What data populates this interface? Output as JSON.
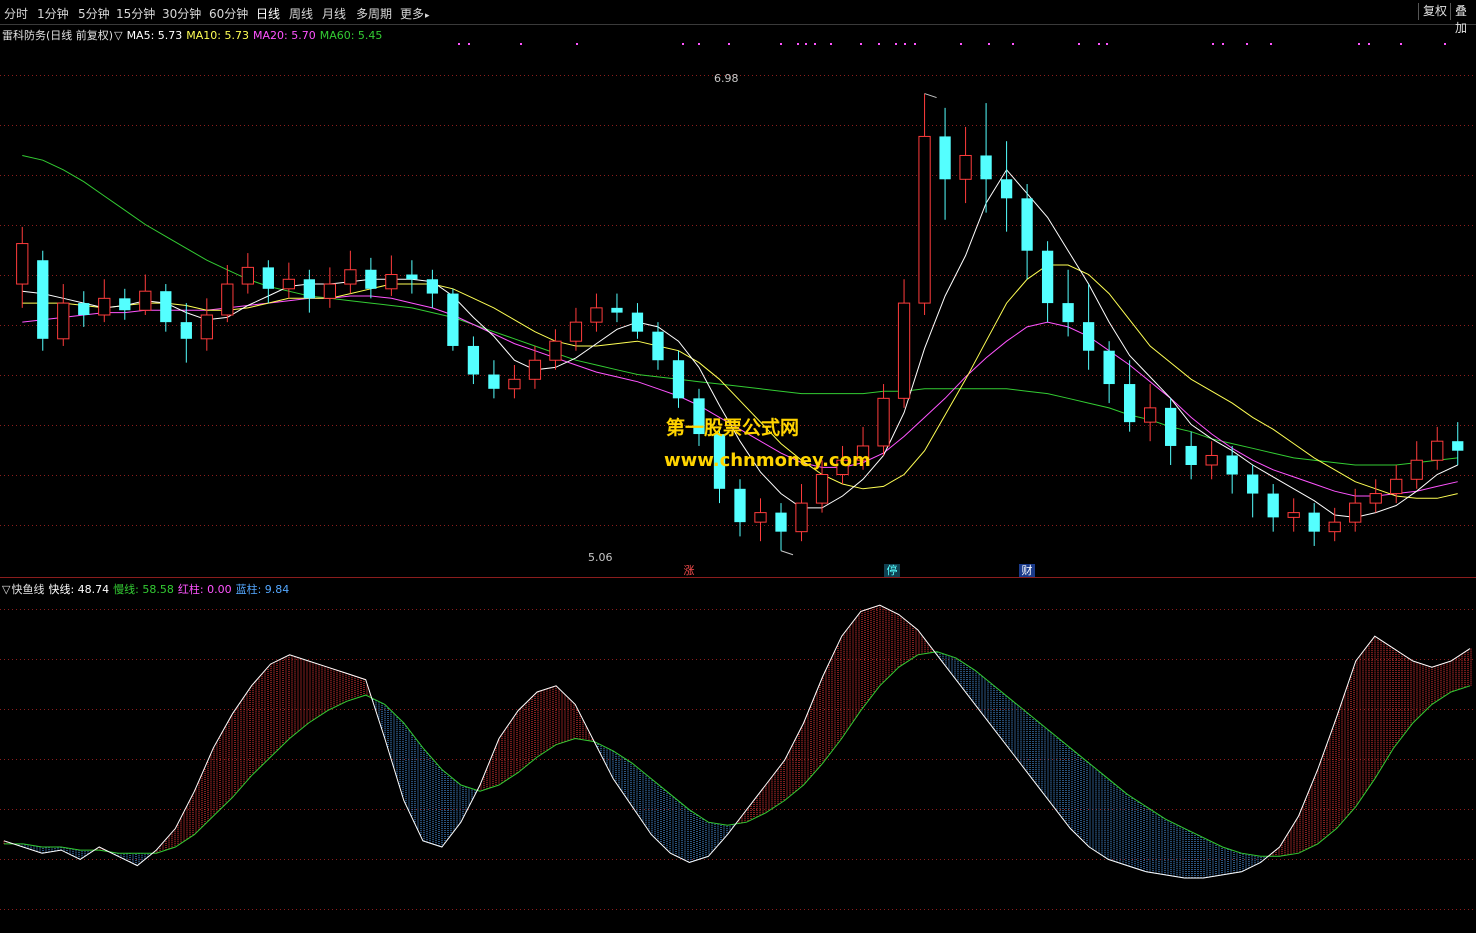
{
  "toolbar": {
    "tabs": [
      {
        "label": "分时",
        "active": false
      },
      {
        "label": "1分钟",
        "active": false
      },
      {
        "label": "5分钟",
        "active": false
      },
      {
        "label": "15分钟",
        "active": false
      },
      {
        "label": "30分钟",
        "active": false
      },
      {
        "label": "60分钟",
        "active": false
      },
      {
        "label": "日线",
        "active": true
      },
      {
        "label": "周线",
        "active": false
      },
      {
        "label": "月线",
        "active": false
      },
      {
        "label": "多周期",
        "active": false
      },
      {
        "label": "更多",
        "active": false
      }
    ],
    "more_arrow": "▸",
    "right_buttons": [
      "复权",
      "叠加"
    ]
  },
  "main_legend": {
    "title": "雷科防务(日线 前复权)",
    "arrow": "▽",
    "ma5": "MA5: 5.73",
    "ma10": "MA10: 5.73",
    "ma20": "MA20: 5.70",
    "ma60": "MA60: 5.45"
  },
  "sub_legend": {
    "arrow": "▽",
    "name": "快鱼线",
    "fast": "快线: 48.74",
    "slow": "慢线: 58.58",
    "red": "红柱: 0.00",
    "blue": "蓝柱: 9.84"
  },
  "annotations": {
    "high": "6.98",
    "low": "5.06"
  },
  "markers": [
    "涨",
    "停",
    "财"
  ],
  "watermark": {
    "line1": "第一股票公式网",
    "line2": "www.chnmoney.com"
  },
  "colors": {
    "up": "#ff3c3c",
    "down": "#54ffff",
    "ma5": "#ffffff",
    "ma10": "#ffff54",
    "ma20": "#ff54ff",
    "ma60": "#33cc33",
    "grid": "#8b1d1d",
    "fast_line": "#ffffff",
    "slow_line": "#33cc33",
    "red_bar": "#ff3c3c",
    "blue_bar": "#54a8ff"
  },
  "chart_data": {
    "type": "candlestick",
    "price_range": [
      5.0,
      7.1
    ],
    "candles": [
      [
        6.18,
        6.35,
        6.42,
        6.08
      ],
      [
        6.28,
        5.95,
        6.32,
        5.9
      ],
      [
        5.95,
        6.1,
        6.18,
        5.92
      ],
      [
        6.1,
        6.05,
        6.15,
        6.0
      ],
      [
        6.05,
        6.12,
        6.2,
        6.02
      ],
      [
        6.12,
        6.07,
        6.16,
        6.03
      ],
      [
        6.07,
        6.15,
        6.22,
        6.05
      ],
      [
        6.15,
        6.02,
        6.18,
        5.98
      ],
      [
        6.02,
        5.95,
        6.1,
        5.85
      ],
      [
        5.95,
        6.05,
        6.12,
        5.9
      ],
      [
        6.05,
        6.18,
        6.26,
        6.02
      ],
      [
        6.18,
        6.25,
        6.31,
        6.14
      ],
      [
        6.25,
        6.16,
        6.28,
        6.1
      ],
      [
        6.16,
        6.2,
        6.27,
        6.12
      ],
      [
        6.2,
        6.12,
        6.24,
        6.06
      ],
      [
        6.12,
        6.18,
        6.25,
        6.08
      ],
      [
        6.18,
        6.24,
        6.32,
        6.14
      ],
      [
        6.24,
        6.16,
        6.29,
        6.12
      ],
      [
        6.16,
        6.22,
        6.3,
        6.13
      ],
      [
        6.22,
        6.2,
        6.28,
        6.14
      ],
      [
        6.2,
        6.14,
        6.24,
        6.08
      ],
      [
        6.14,
        5.92,
        6.16,
        5.9
      ],
      [
        5.92,
        5.8,
        5.96,
        5.76
      ],
      [
        5.8,
        5.74,
        5.86,
        5.7
      ],
      [
        5.74,
        5.78,
        5.84,
        5.7
      ],
      [
        5.78,
        5.86,
        5.92,
        5.74
      ],
      [
        5.86,
        5.94,
        5.99,
        5.82
      ],
      [
        5.94,
        6.02,
        6.08,
        5.9
      ],
      [
        6.02,
        6.08,
        6.14,
        5.98
      ],
      [
        6.08,
        6.06,
        6.14,
        6.02
      ],
      [
        6.06,
        5.98,
        6.1,
        5.95
      ],
      [
        5.98,
        5.86,
        6.02,
        5.82
      ],
      [
        5.86,
        5.7,
        5.9,
        5.66
      ],
      [
        5.7,
        5.55,
        5.74,
        5.5
      ],
      [
        5.55,
        5.32,
        5.58,
        5.26
      ],
      [
        5.32,
        5.18,
        5.36,
        5.12
      ],
      [
        5.18,
        5.22,
        5.28,
        5.1
      ],
      [
        5.22,
        5.14,
        5.26,
        5.06
      ],
      [
        5.14,
        5.26,
        5.34,
        5.1
      ],
      [
        5.26,
        5.38,
        5.44,
        5.22
      ],
      [
        5.38,
        5.44,
        5.5,
        5.34
      ],
      [
        5.44,
        5.5,
        5.58,
        5.4
      ],
      [
        5.5,
        5.7,
        5.76,
        5.46
      ],
      [
        5.7,
        6.1,
        6.2,
        5.66
      ],
      [
        6.1,
        6.8,
        6.98,
        6.05
      ],
      [
        6.8,
        6.62,
        6.92,
        6.45
      ],
      [
        6.62,
        6.72,
        6.84,
        6.52
      ],
      [
        6.72,
        6.62,
        6.94,
        6.48
      ],
      [
        6.62,
        6.54,
        6.78,
        6.4
      ],
      [
        6.54,
        6.32,
        6.6,
        6.2
      ],
      [
        6.32,
        6.1,
        6.36,
        6.02
      ],
      [
        6.1,
        6.02,
        6.24,
        5.96
      ],
      [
        6.02,
        5.9,
        6.18,
        5.82
      ],
      [
        5.9,
        5.76,
        5.94,
        5.68
      ],
      [
        5.76,
        5.6,
        5.86,
        5.56
      ],
      [
        5.6,
        5.66,
        5.76,
        5.52
      ],
      [
        5.66,
        5.5,
        5.7,
        5.42
      ],
      [
        5.5,
        5.42,
        5.56,
        5.36
      ],
      [
        5.42,
        5.46,
        5.52,
        5.36
      ],
      [
        5.46,
        5.38,
        5.5,
        5.3
      ],
      [
        5.38,
        5.3,
        5.42,
        5.2
      ],
      [
        5.3,
        5.2,
        5.34,
        5.14
      ],
      [
        5.2,
        5.22,
        5.28,
        5.14
      ],
      [
        5.22,
        5.14,
        5.26,
        5.08
      ],
      [
        5.14,
        5.18,
        5.24,
        5.1
      ],
      [
        5.18,
        5.26,
        5.32,
        5.14
      ],
      [
        5.26,
        5.3,
        5.36,
        5.22
      ],
      [
        5.3,
        5.36,
        5.42,
        5.26
      ],
      [
        5.36,
        5.44,
        5.52,
        5.32
      ],
      [
        5.44,
        5.52,
        5.58,
        5.4
      ],
      [
        5.52,
        5.48,
        5.6,
        5.42
      ]
    ],
    "ma5": [
      6.15,
      6.14,
      6.12,
      6.1,
      6.08,
      6.09,
      6.11,
      6.1,
      6.06,
      6.03,
      6.04,
      6.09,
      6.13,
      6.17,
      6.18,
      6.18,
      6.19,
      6.2,
      6.2,
      6.2,
      6.19,
      6.13,
      6.04,
      5.96,
      5.86,
      5.82,
      5.83,
      5.87,
      5.93,
      5.99,
      6.02,
      6.0,
      5.94,
      5.83,
      5.67,
      5.52,
      5.39,
      5.3,
      5.24,
      5.24,
      5.29,
      5.36,
      5.46,
      5.64,
      5.91,
      6.13,
      6.3,
      6.52,
      6.66,
      6.56,
      6.46,
      6.32,
      6.18,
      6.02,
      5.88,
      5.79,
      5.7,
      5.59,
      5.53,
      5.48,
      5.42,
      5.37,
      5.32,
      5.27,
      5.21,
      5.2,
      5.22,
      5.25,
      5.31,
      5.38,
      5.42
    ],
    "ma10": [
      6.1,
      6.1,
      6.1,
      6.09,
      6.08,
      6.09,
      6.1,
      6.1,
      6.09,
      6.07,
      6.07,
      6.08,
      6.1,
      6.12,
      6.12,
      6.12,
      6.14,
      6.16,
      6.18,
      6.18,
      6.18,
      6.16,
      6.12,
      6.08,
      6.03,
      5.98,
      5.94,
      5.92,
      5.92,
      5.93,
      5.94,
      5.92,
      5.9,
      5.85,
      5.78,
      5.69,
      5.6,
      5.51,
      5.44,
      5.38,
      5.34,
      5.32,
      5.33,
      5.38,
      5.48,
      5.63,
      5.78,
      5.94,
      6.1,
      6.2,
      6.26,
      6.26,
      6.22,
      6.14,
      6.03,
      5.92,
      5.85,
      5.78,
      5.73,
      5.68,
      5.62,
      5.57,
      5.51,
      5.45,
      5.4,
      5.35,
      5.32,
      5.29,
      5.28,
      5.28,
      5.3
    ],
    "ma20": [
      6.02,
      6.03,
      6.04,
      6.05,
      6.06,
      6.06,
      6.07,
      6.07,
      6.07,
      6.07,
      6.08,
      6.09,
      6.1,
      6.11,
      6.12,
      6.12,
      6.13,
      6.13,
      6.12,
      6.1,
      6.08,
      6.05,
      6.01,
      5.97,
      5.93,
      5.9,
      5.87,
      5.84,
      5.81,
      5.79,
      5.77,
      5.74,
      5.71,
      5.67,
      5.62,
      5.57,
      5.52,
      5.47,
      5.43,
      5.41,
      5.41,
      5.43,
      5.47,
      5.54,
      5.62,
      5.7,
      5.79,
      5.87,
      5.94,
      6.0,
      6.02,
      6.0,
      5.96,
      5.9,
      5.84,
      5.77,
      5.7,
      5.62,
      5.55,
      5.49,
      5.44,
      5.4,
      5.37,
      5.34,
      5.31,
      5.29,
      5.29,
      5.3,
      5.31,
      5.33,
      5.35
    ],
    "ma60": [
      6.72,
      6.7,
      6.66,
      6.61,
      6.55,
      6.49,
      6.43,
      6.38,
      6.33,
      6.28,
      6.24,
      6.2,
      6.17,
      6.15,
      6.13,
      6.12,
      6.11,
      6.1,
      6.09,
      6.08,
      6.06,
      6.04,
      6.01,
      5.98,
      5.95,
      5.92,
      5.89,
      5.86,
      5.84,
      5.82,
      5.8,
      5.79,
      5.78,
      5.77,
      5.76,
      5.75,
      5.74,
      5.73,
      5.72,
      5.72,
      5.72,
      5.72,
      5.73,
      5.73,
      5.74,
      5.74,
      5.74,
      5.74,
      5.74,
      5.73,
      5.72,
      5.7,
      5.68,
      5.66,
      5.63,
      5.61,
      5.58,
      5.56,
      5.53,
      5.51,
      5.49,
      5.47,
      5.45,
      5.44,
      5.43,
      5.42,
      5.42,
      5.42,
      5.43,
      5.44,
      5.45
    ],
    "fast": [
      22,
      20,
      18,
      19,
      16,
      20,
      17,
      14,
      19,
      26,
      38,
      52,
      63,
      72,
      79,
      82,
      80,
      78,
      76,
      74,
      55,
      35,
      22,
      20,
      28,
      40,
      55,
      64,
      70,
      72,
      66,
      54,
      42,
      33,
      24,
      18,
      15,
      17,
      24,
      32,
      40,
      48,
      60,
      75,
      88,
      96,
      98,
      95,
      90,
      82,
      74,
      66,
      58,
      50,
      42,
      34,
      26,
      20,
      16,
      14,
      12,
      11,
      10,
      10,
      11,
      12,
      15,
      20,
      30,
      45,
      62,
      80,
      88,
      84,
      80,
      78,
      80,
      84
    ],
    "slow": [
      21,
      21,
      20,
      20,
      19,
      19,
      18,
      18,
      18,
      20,
      24,
      30,
      36,
      43,
      49,
      55,
      60,
      64,
      67,
      69,
      66,
      60,
      52,
      45,
      40,
      38,
      40,
      44,
      49,
      53,
      55,
      54,
      51,
      47,
      42,
      37,
      32,
      28,
      27,
      28,
      31,
      35,
      40,
      47,
      55,
      64,
      72,
      78,
      82,
      83,
      81,
      77,
      72,
      67,
      62,
      57,
      52,
      47,
      42,
      37,
      33,
      29,
      26,
      23,
      20,
      18,
      17,
      17,
      18,
      21,
      26,
      33,
      42,
      52,
      60,
      66,
      70,
      72
    ]
  }
}
